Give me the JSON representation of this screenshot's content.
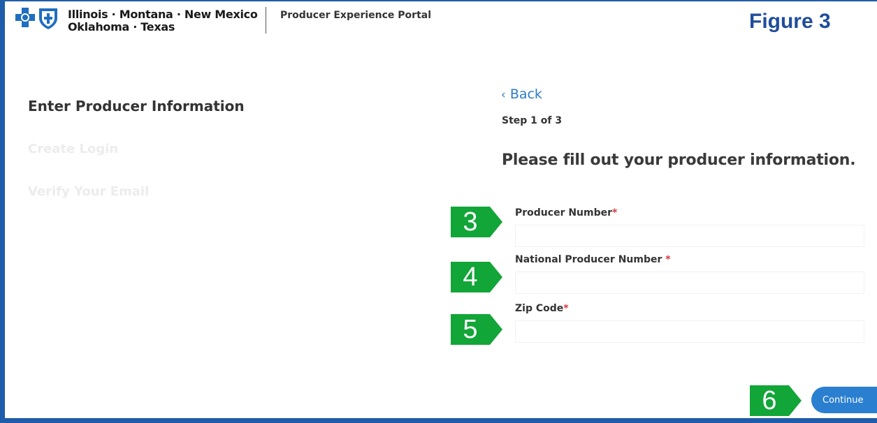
{
  "header": {
    "brand_line1": "Illinois · Montana · New Mexico",
    "brand_line2": "Oklahoma · Texas",
    "portal_name": "Producer Experience Portal",
    "logo_icons": [
      "blue-cross-icon",
      "blue-shield-icon"
    ]
  },
  "figure_label": "Figure 3",
  "steps": [
    {
      "label": "Enter Producer Information",
      "state": "active"
    },
    {
      "label": "Create Login",
      "state": "inactive"
    },
    {
      "label": "Verify Your Email",
      "state": "inactive"
    }
  ],
  "form": {
    "back_label": "Back",
    "step_counter": "Step 1 of 3",
    "heading": "Please fill out your producer information.",
    "fields": [
      {
        "label": "Producer Number",
        "required_mark": "*",
        "value": "",
        "placeholder": ""
      },
      {
        "label": "National Producer Number ",
        "required_mark": "*",
        "value": "",
        "placeholder": ""
      },
      {
        "label": "Zip Code",
        "required_mark": "*",
        "value": "",
        "placeholder": ""
      }
    ],
    "continue_label": "Continue"
  },
  "callouts": [
    "3",
    "4",
    "5",
    "6"
  ],
  "colors": {
    "frame_blue": "#1f5ca9",
    "figure_label": "#1f4d9a",
    "link_blue": "#2c7cc4",
    "button_blue": "#2b7fd0",
    "callout_green": "#12a538",
    "required_red": "#d9363e"
  }
}
